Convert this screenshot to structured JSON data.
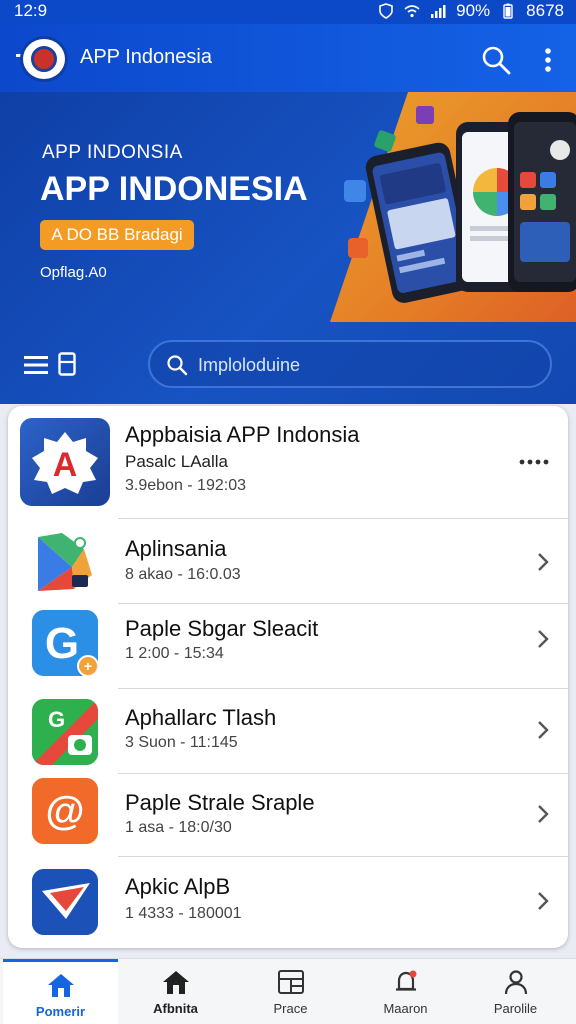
{
  "status_bar": {
    "time": "12:9",
    "battery": "90%",
    "extra": "8678"
  },
  "app_bar": {
    "title": "APP Indonesia",
    "icons": [
      "search-icon",
      "more-vert-icon"
    ]
  },
  "hero": {
    "kicker": "APP INDONSIA",
    "title": "APP INDONESIA",
    "cta_label": "A DO BB Bradagi",
    "subtitle": "Opflag.A0",
    "search_placeholder": "Imploloduine"
  },
  "apps": [
    {
      "name": "Appbaisia APP Indonsia",
      "sub": "Pasalc LAalla",
      "meta": "3.9ebon - 192:03",
      "icon": "red-a-icon"
    },
    {
      "name": "Aplinsania",
      "meta": "8 akao - 16:0.03",
      "icon": "colorful-share-icon"
    },
    {
      "name": "Paple Sbgar Sleacit",
      "meta": "1 2:00 - 15:34",
      "icon": "blue-g-icon"
    },
    {
      "name": "Aphallarc Tlash",
      "meta": "3 Suon - 11:145",
      "icon": "green-camera-icon"
    },
    {
      "name": "Paple Strale Sraple",
      "meta": "1 asa - 18:0/30",
      "icon": "orange-at-icon"
    },
    {
      "name": "Apkic AlpB",
      "meta": "1 4333 - 180001",
      "icon": "blue-arrow-icon"
    }
  ],
  "bottom_nav": [
    {
      "label": "Pomerir",
      "icon": "home-icon",
      "active": true
    },
    {
      "label": "Afbnita",
      "icon": "home-icon",
      "active": false
    },
    {
      "label": "Prace",
      "icon": "grid-icon",
      "active": false
    },
    {
      "label": "Maaron",
      "icon": "bell-icon",
      "active": false
    },
    {
      "label": "Parolile",
      "icon": "person-icon",
      "active": false
    }
  ],
  "colors": {
    "primary": "#0c48cc",
    "accent": "#f49b26",
    "active_nav": "#1565e0"
  }
}
